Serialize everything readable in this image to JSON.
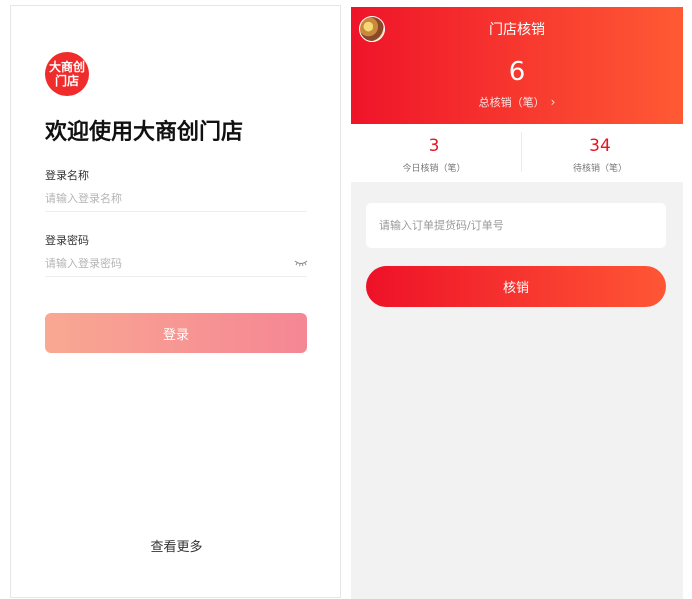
{
  "login": {
    "logo_line1": "大商创",
    "logo_line2": "门店",
    "welcome": "欢迎使用大商创门店",
    "username_label": "登录名称",
    "username_placeholder": "请输入登录名称",
    "password_label": "登录密码",
    "password_placeholder": "请输入登录密码",
    "login_button": "登录",
    "more_link": "查看更多",
    "eye_icon": "eye-closed-icon"
  },
  "verify": {
    "title": "门店核销",
    "total_value": "6",
    "total_label": "总核销（笔）",
    "chevron": "›",
    "stats": [
      {
        "value": "3",
        "label": "今日核销（笔）"
      },
      {
        "value": "34",
        "label": "待核销（笔）"
      }
    ],
    "order_placeholder": "请输入订单提货码/订单号",
    "verify_button": "核销"
  },
  "colors": {
    "brand_red": "#ef1429",
    "brand_orange": "#ff5a34",
    "login_button_start": "#f9a892",
    "login_button_end": "#f58694"
  }
}
